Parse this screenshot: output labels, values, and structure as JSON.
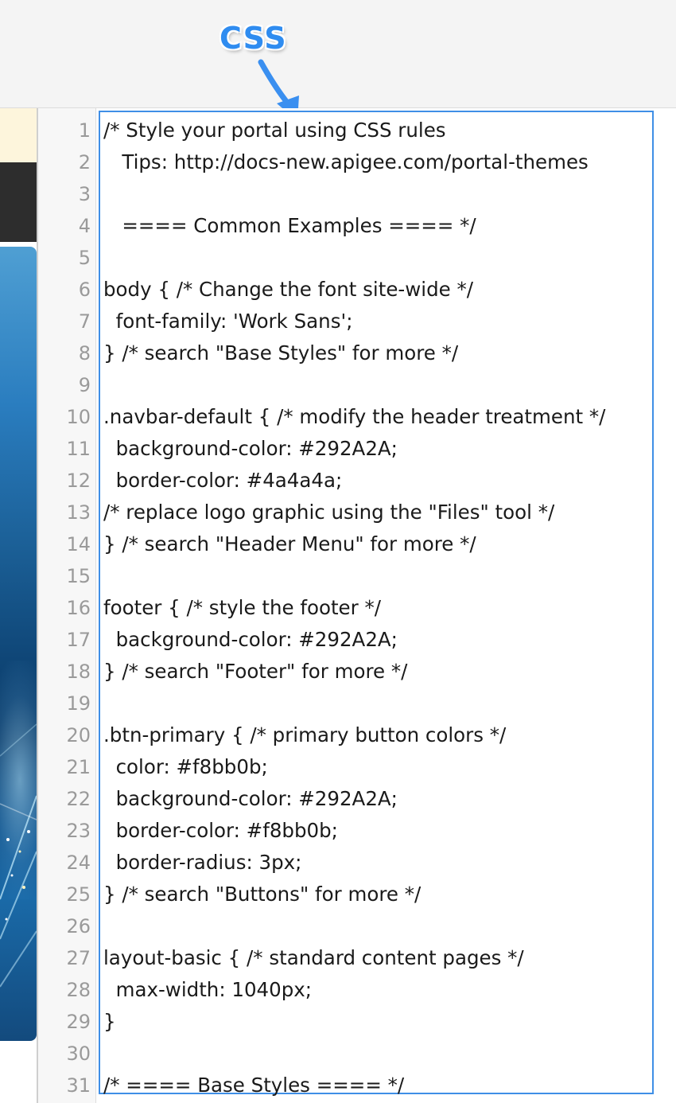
{
  "callout": {
    "label": "CSS"
  },
  "editor": {
    "lines": [
      "/* Style your portal using CSS rules",
      "   Tips: http://docs-new.apigee.com/portal-themes",
      "",
      "   ==== Common Examples ==== */",
      "",
      "body { /* Change the font site-wide */",
      "  font-family: 'Work Sans';",
      "} /* search \"Base Styles\" for more */",
      "",
      ".navbar-default { /* modify the header treatment */",
      "  background-color: #292A2A;",
      "  border-color: #4a4a4a;",
      "/* replace logo graphic using the \"Files\" tool */",
      "} /* search \"Header Menu\" for more */",
      "",
      "footer { /* style the footer */",
      "  background-color: #292A2A;",
      "} /* search \"Footer\" for more */",
      "",
      ".btn-primary { /* primary button colors */",
      "  color: #f8bb0b;",
      "  background-color: #292A2A;",
      "  border-color: #f8bb0b;",
      "  border-radius: 3px;",
      "} /* search \"Buttons\" for more */",
      "",
      "layout-basic { /* standard content pages */",
      "  max-width: 1040px;",
      "}",
      "",
      "/* ==== Base Styles ==== */"
    ]
  },
  "colors": {
    "callout": "#2f8cf0",
    "selection_border": "#3f8fe6",
    "line_number": "#9a9a9a"
  },
  "icons": {
    "arrow": "callout-arrow-icon"
  }
}
